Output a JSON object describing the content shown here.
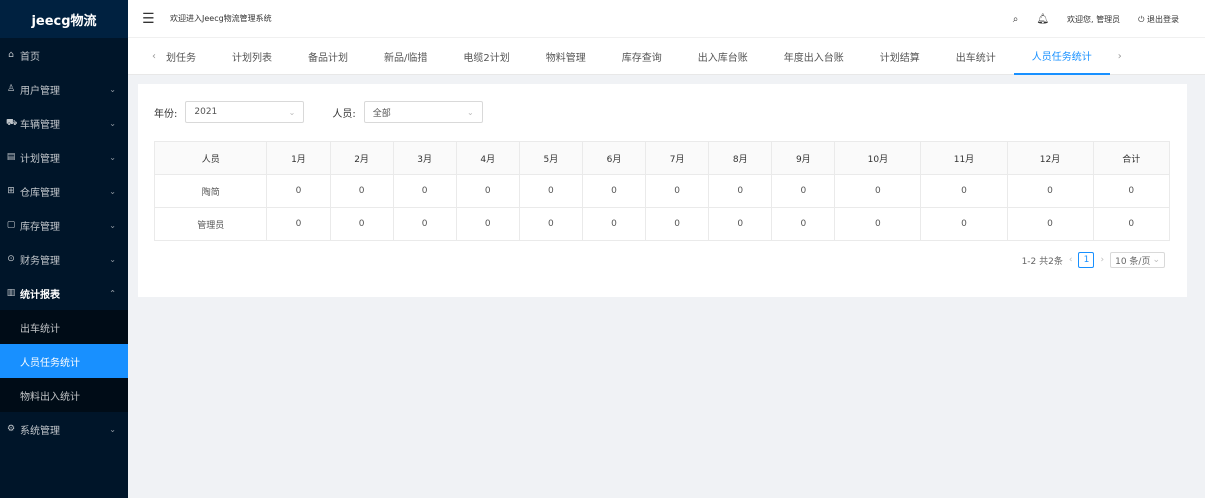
{
  "app": {
    "logo": "jeecg物流"
  },
  "header": {
    "welcome": "欢迎进入Jeecg物流管理系统",
    "user_greeting": "欢迎您, 管理员",
    "logout": "退出登录"
  },
  "sidebar": {
    "items": [
      {
        "label": "首页",
        "icon": "home-icon",
        "glyph": "⌂"
      },
      {
        "label": "用户管理",
        "icon": "user-icon",
        "glyph": "♙"
      },
      {
        "label": "车辆管理",
        "icon": "car-icon",
        "glyph": "⛟"
      },
      {
        "label": "计划管理",
        "icon": "file-icon",
        "glyph": "▤"
      },
      {
        "label": "仓库管理",
        "icon": "warehouse-icon",
        "glyph": "⊞"
      },
      {
        "label": "库存管理",
        "icon": "inventory-icon",
        "glyph": "▢"
      },
      {
        "label": "财务管理",
        "icon": "finance-icon",
        "glyph": "⊙"
      },
      {
        "label": "统计报表",
        "icon": "chart-icon",
        "glyph": "▥"
      },
      {
        "label": "系统管理",
        "icon": "settings-icon",
        "glyph": "⚙"
      }
    ],
    "sub_items": [
      "出车统计",
      "人员任务统计",
      "物料出入统计"
    ]
  },
  "tabs": [
    "计划列表",
    "备品计划",
    "新品/临措",
    "电缆2计划",
    "物料管理",
    "库存查询",
    "出入库台账",
    "年度出入台账",
    "计划结算",
    "出车统计",
    "人员任务统计"
  ],
  "tabs_partial": "划任务",
  "filters": {
    "year_label": "年份:",
    "year_value": "2021",
    "person_label": "人员:",
    "person_value": "全部"
  },
  "table": {
    "headers": [
      "人员",
      "1月",
      "2月",
      "3月",
      "4月",
      "5月",
      "6月",
      "7月",
      "8月",
      "9月",
      "10月",
      "11月",
      "12月",
      "合计"
    ],
    "rows": [
      [
        "陶简",
        "0",
        "0",
        "0",
        "0",
        "0",
        "0",
        "0",
        "0",
        "0",
        "0",
        "0",
        "0",
        "0"
      ],
      [
        "管理员",
        "0",
        "0",
        "0",
        "0",
        "0",
        "0",
        "0",
        "0",
        "0",
        "0",
        "0",
        "0",
        "0"
      ]
    ]
  },
  "pager": {
    "summary": "1-2 共2条",
    "current": "1",
    "page_size": "10 条/页"
  },
  "colors": {
    "primary": "#1890ff",
    "sidebar_bg": "#001529"
  }
}
